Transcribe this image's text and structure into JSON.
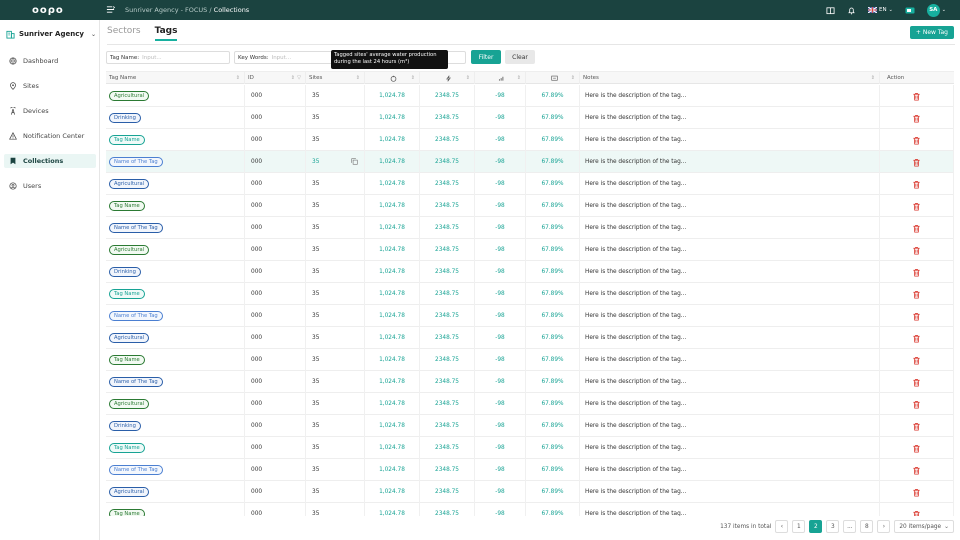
{
  "app": {
    "logo_text": "ooρo",
    "breadcrumb": {
      "org": "Sunriver Agency - FOCUS",
      "separator": "/",
      "current": "Collections"
    },
    "language": "EN",
    "user_initials": "SA"
  },
  "sidebar": {
    "agency_name": "Sunriver Agency",
    "items": [
      {
        "label": "Dashboard",
        "icon": "globe-icon"
      },
      {
        "label": "Sites",
        "icon": "location-pin-icon"
      },
      {
        "label": "Devices",
        "icon": "tower-icon"
      },
      {
        "label": "Notification Center",
        "icon": "warning-icon"
      },
      {
        "label": "Collections",
        "icon": "bookmark-icon"
      },
      {
        "label": "Users",
        "icon": "user-circle-icon"
      }
    ],
    "active_index": 4
  },
  "tabs": [
    {
      "label": "Sectors"
    },
    {
      "label": "Tags"
    }
  ],
  "active_tab": 1,
  "new_tag_label": "+ New Tag",
  "filters": {
    "tag_name": {
      "label": "Tag Name:",
      "placeholder": "Input..."
    },
    "key_words": {
      "label": "Key Words:",
      "placeholder": "Input..."
    },
    "filter_label": "Filter",
    "clear_label": "Clear"
  },
  "tooltip": {
    "line1": "Tagged sites' average water production",
    "line2": "during the last 24 hours (m³)"
  },
  "table": {
    "columns": {
      "tag_name": "Tag Name",
      "id": "ID",
      "sites": "Sites",
      "notes": "Notes",
      "action": "Action"
    },
    "rows": [
      {
        "tag": "Agricultural",
        "style": "green",
        "id": "000",
        "sites": "35",
        "v1": "1,024.78",
        "v2": "2348.75",
        "v3": "-98",
        "v4": "67.89%",
        "note": "Here is the description of the tag..."
      },
      {
        "tag": "Drinking",
        "style": "blue",
        "id": "000",
        "sites": "35",
        "v1": "1,024.78",
        "v2": "2348.75",
        "v3": "-98",
        "v4": "67.89%",
        "note": "Here is the description of the tag..."
      },
      {
        "tag": "Tag Name",
        "style": "teal",
        "id": "000",
        "sites": "35",
        "v1": "1,024.78",
        "v2": "2348.75",
        "v3": "-98",
        "v4": "67.89%",
        "note": "Here is the description of the tag..."
      },
      {
        "tag": "Name of The Tag",
        "style": "lblue",
        "id": "000",
        "sites": "35",
        "v1": "1,024.78",
        "v2": "2348.75",
        "v3": "-98",
        "v4": "67.89%",
        "note": "Here is the description of the tag..."
      },
      {
        "tag": "Agricultural",
        "style": "blue",
        "id": "000",
        "sites": "35",
        "v1": "1,024.78",
        "v2": "2348.75",
        "v3": "-98",
        "v4": "67.89%",
        "note": "Here is the description of the tag..."
      },
      {
        "tag": "Tag Name",
        "style": "green",
        "id": "000",
        "sites": "35",
        "v1": "1,024.78",
        "v2": "2348.75",
        "v3": "-98",
        "v4": "67.89%",
        "note": "Here is the description of the tag..."
      },
      {
        "tag": "Name of The Tag",
        "style": "blue",
        "id": "000",
        "sites": "35",
        "v1": "1,024.78",
        "v2": "2348.75",
        "v3": "-98",
        "v4": "67.89%",
        "note": "Here is the description of the tag..."
      },
      {
        "tag": "Agricultural",
        "style": "green",
        "id": "000",
        "sites": "35",
        "v1": "1,024.78",
        "v2": "2348.75",
        "v3": "-98",
        "v4": "67.89%",
        "note": "Here is the description of the tag..."
      },
      {
        "tag": "Drinking",
        "style": "blue",
        "id": "000",
        "sites": "35",
        "v1": "1,024.78",
        "v2": "2348.75",
        "v3": "-98",
        "v4": "67.89%",
        "note": "Here is the description of the tag..."
      },
      {
        "tag": "Tag Name",
        "style": "teal",
        "id": "000",
        "sites": "35",
        "v1": "1,024.78",
        "v2": "2348.75",
        "v3": "-98",
        "v4": "67.89%",
        "note": "Here is the description of the tag..."
      },
      {
        "tag": "Name of The Tag",
        "style": "lblue",
        "id": "000",
        "sites": "35",
        "v1": "1,024.78",
        "v2": "2348.75",
        "v3": "-98",
        "v4": "67.89%",
        "note": "Here is the description of the tag..."
      },
      {
        "tag": "Agricultural",
        "style": "blue",
        "id": "000",
        "sites": "35",
        "v1": "1,024.78",
        "v2": "2348.75",
        "v3": "-98",
        "v4": "67.89%",
        "note": "Here is the description of the tag..."
      },
      {
        "tag": "Tag Name",
        "style": "green",
        "id": "000",
        "sites": "35",
        "v1": "1,024.78",
        "v2": "2348.75",
        "v3": "-98",
        "v4": "67.89%",
        "note": "Here is the description of the tag..."
      },
      {
        "tag": "Name of The Tag",
        "style": "blue",
        "id": "000",
        "sites": "35",
        "v1": "1,024.78",
        "v2": "2348.75",
        "v3": "-98",
        "v4": "67.89%",
        "note": "Here is the description of the tag..."
      },
      {
        "tag": "Agricultural",
        "style": "green",
        "id": "000",
        "sites": "35",
        "v1": "1,024.78",
        "v2": "2348.75",
        "v3": "-98",
        "v4": "67.89%",
        "note": "Here is the description of the tag..."
      },
      {
        "tag": "Drinking",
        "style": "blue",
        "id": "000",
        "sites": "35",
        "v1": "1,024.78",
        "v2": "2348.75",
        "v3": "-98",
        "v4": "67.89%",
        "note": "Here is the description of the tag..."
      },
      {
        "tag": "Tag Name",
        "style": "teal",
        "id": "000",
        "sites": "35",
        "v1": "1,024.78",
        "v2": "2348.75",
        "v3": "-98",
        "v4": "67.89%",
        "note": "Here is the description of the tag..."
      },
      {
        "tag": "Name of The Tag",
        "style": "lblue",
        "id": "000",
        "sites": "35",
        "v1": "1,024.78",
        "v2": "2348.75",
        "v3": "-98",
        "v4": "67.89%",
        "note": "Here is the description of the tag..."
      },
      {
        "tag": "Agricultural",
        "style": "blue",
        "id": "000",
        "sites": "35",
        "v1": "1,024.78",
        "v2": "2348.75",
        "v3": "-98",
        "v4": "67.89%",
        "note": "Here is the description of the tag..."
      },
      {
        "tag": "Tag Name",
        "style": "green",
        "id": "000",
        "sites": "35",
        "v1": "1,024.78",
        "v2": "2348.75",
        "v3": "-98",
        "v4": "67.89%",
        "note": "Here is the description of the tag..."
      }
    ],
    "highlighted_row": 3
  },
  "pagination": {
    "total_text": "137 items in total",
    "prev": "‹",
    "pages": [
      "1",
      "2",
      "3",
      "...",
      "8"
    ],
    "current_page": "2",
    "next": "›",
    "page_size": "20 items/page"
  },
  "colors": {
    "brand": "#17a394",
    "topbar": "#1b4340",
    "delete": "#d9362c"
  }
}
